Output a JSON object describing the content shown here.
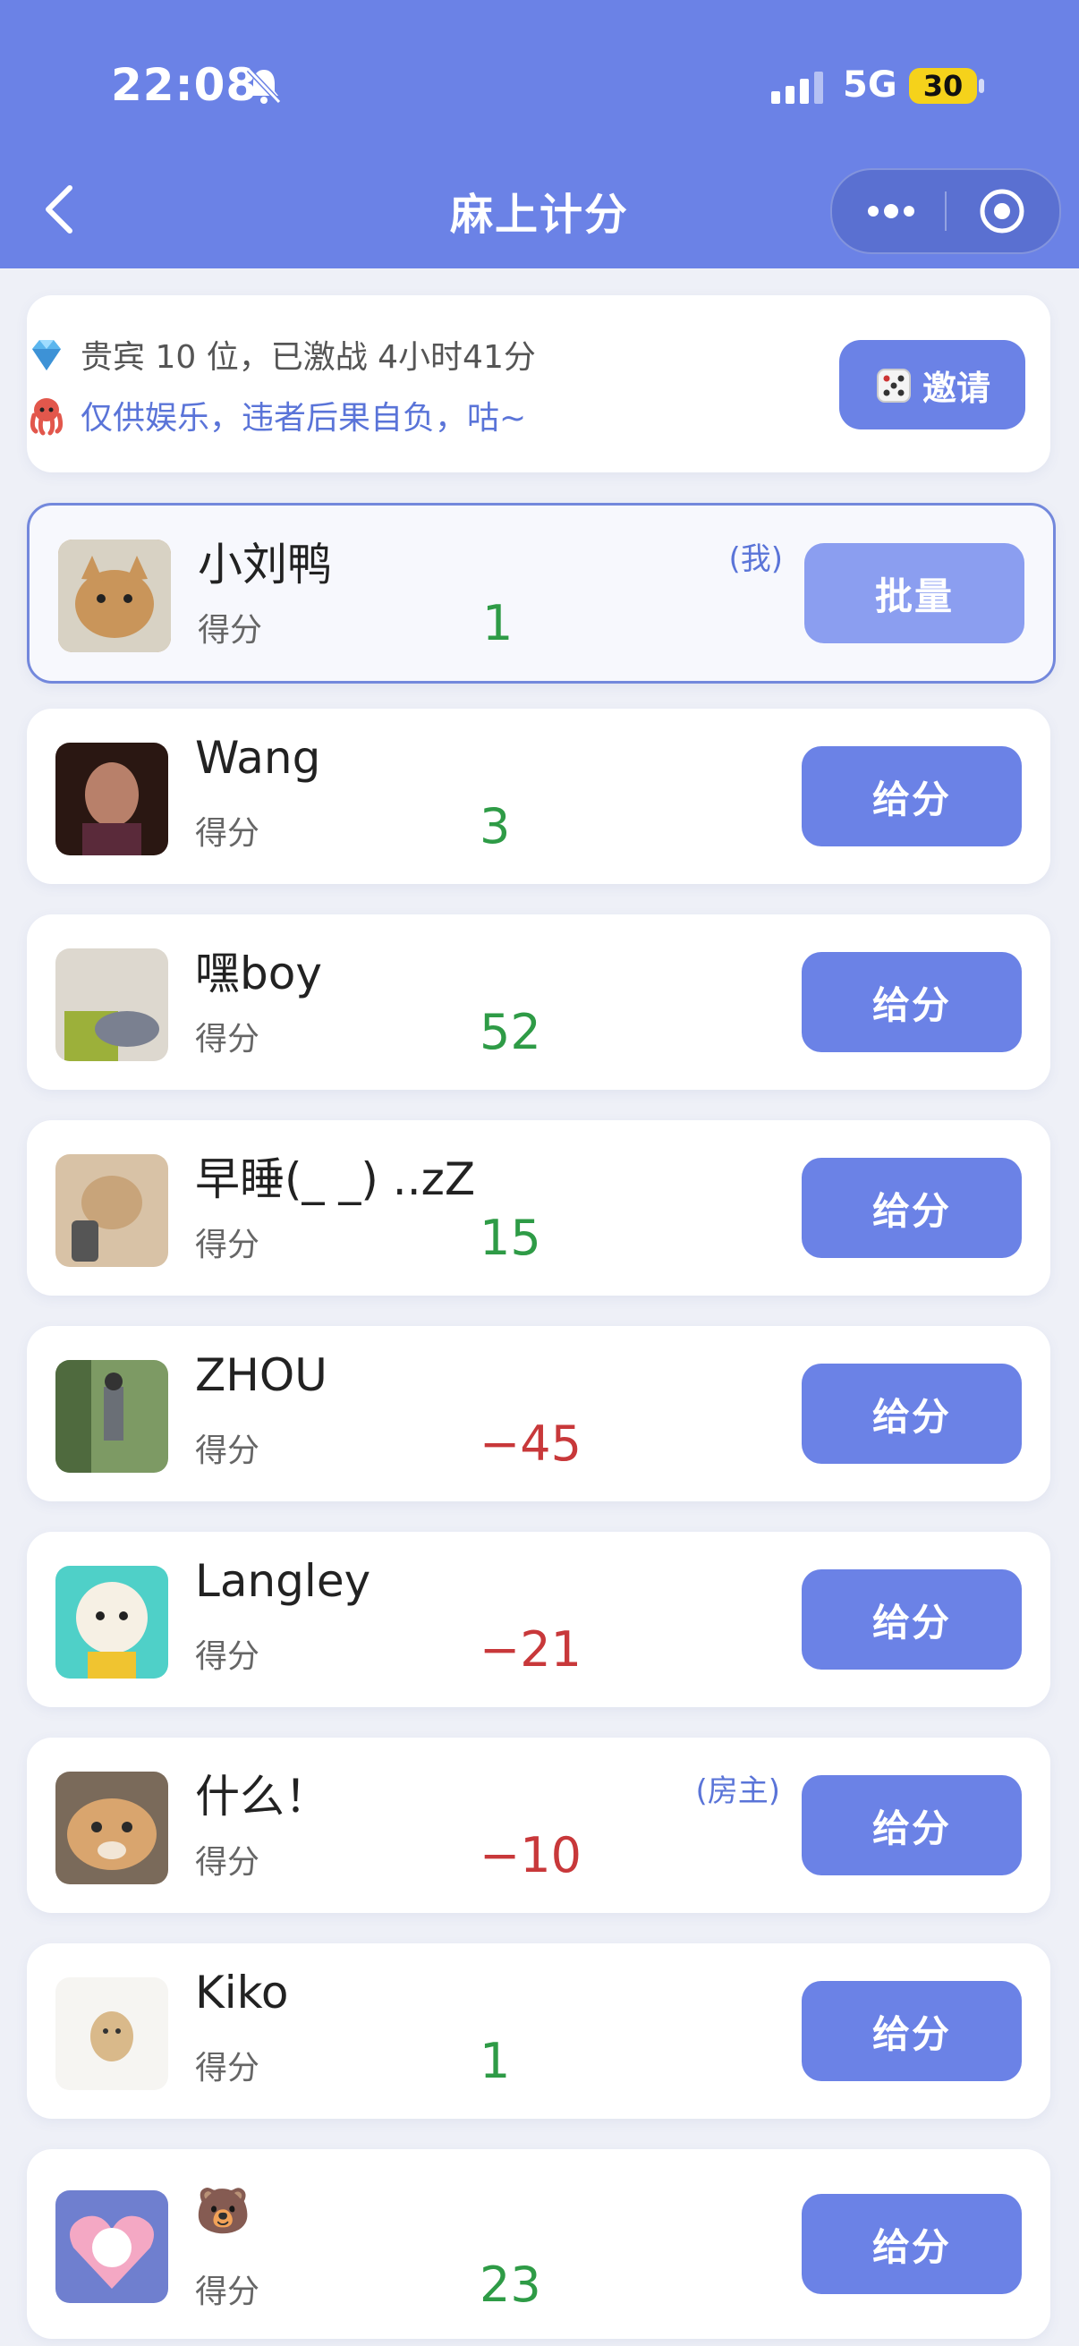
{
  "status_bar": {
    "time": "22:08",
    "network": "5G",
    "battery": "30"
  },
  "nav": {
    "title": "麻上计分",
    "back_icon": "chevron-left-icon",
    "more_icon": "more-dots-icon",
    "target_icon": "record-target-icon"
  },
  "info": {
    "line1": "贵宾 10 位，已激战 4小时41分",
    "line2": "仅供娱乐，违者后果自负，咕~",
    "invite_label": "邀请",
    "icons": [
      "diamond-icon",
      "octopus-icon",
      "dice-icon"
    ]
  },
  "score_label": "得分",
  "players": [
    {
      "name": "小刘鸭",
      "score": "1",
      "tag": "(我)",
      "button": "批量",
      "avatar_color": "#c9a06a"
    },
    {
      "name": "Wang",
      "score": "3",
      "tag": "",
      "button": "给分",
      "avatar_color": "#3a1f1a"
    },
    {
      "name": "嘿boy",
      "score": "52",
      "tag": "",
      "button": "给分",
      "avatar_color": "#9aa080"
    },
    {
      "name": "早睡(_ _) ..zZ",
      "score": "15",
      "tag": "",
      "button": "给分",
      "avatar_color": "#c9a987"
    },
    {
      "name": "ZHOU",
      "score": "−45",
      "tag": "",
      "button": "给分",
      "avatar_color": "#6f8a5a"
    },
    {
      "name": "Langley",
      "score": "−21",
      "tag": "",
      "button": "给分",
      "avatar_color": "#f0d85a"
    },
    {
      "name": "什么！",
      "score": "−10",
      "tag": "(房主)",
      "button": "给分",
      "avatar_color": "#b9875a"
    },
    {
      "name": "Kiko",
      "score": "1",
      "tag": "",
      "button": "给分",
      "avatar_color": "#f2f2f0"
    },
    {
      "name": "🐻",
      "score": "23",
      "tag": "",
      "button": "给分",
      "avatar_color": "#e98aa8"
    }
  ],
  "colors": {
    "header": "#6b82e6",
    "button": "#6b82e6",
    "positive": "#2e9b46",
    "negative": "#c8383a"
  }
}
